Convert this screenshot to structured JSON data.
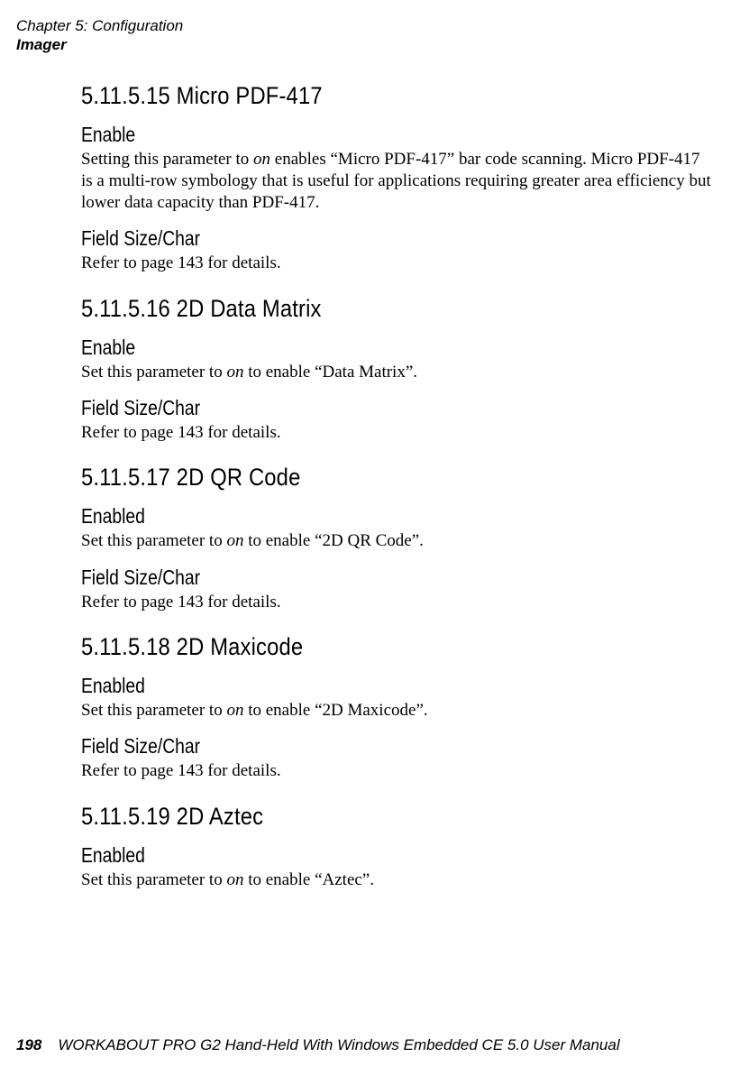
{
  "header": {
    "chapter_label": "Chapter 5: Configuration",
    "section_name": "Imager"
  },
  "sections": {
    "s1": {
      "title": "5.11.5.15  Micro PDF-417",
      "sub1_title": "Enable",
      "sub1_body_prefix": "Setting this parameter to ",
      "sub1_body_em": "on",
      "sub1_body_suffix": " enables “Micro PDF-417” bar code scanning. Micro PDF-417 is a multi-row symbology that is useful for applications requiring greater area efficiency but lower data capacity than PDF-417.",
      "sub2_title": "Field Size/Char",
      "sub2_body": "Refer to page 143 for details."
    },
    "s2": {
      "title": "5.11.5.16  2D Data Matrix",
      "sub1_title": "Enable",
      "sub1_body_prefix": "Set this parameter to ",
      "sub1_body_em": "on",
      "sub1_body_suffix": " to enable “Data Matrix”.",
      "sub2_title": "Field Size/Char",
      "sub2_body": "Refer to page 143 for details."
    },
    "s3": {
      "title": "5.11.5.17  2D QR Code",
      "sub1_title": "Enabled",
      "sub1_body_prefix": "Set this parameter to ",
      "sub1_body_em": "on",
      "sub1_body_suffix": " to enable “2D QR Code”.",
      "sub2_title": "Field Size/Char",
      "sub2_body": "Refer to page 143 for details."
    },
    "s4": {
      "title": "5.11.5.18  2D Maxicode",
      "sub1_title": "Enabled",
      "sub1_body_prefix": "Set this parameter to ",
      "sub1_body_em": "on",
      "sub1_body_suffix": " to enable “2D Maxicode”.",
      "sub2_title": "Field Size/Char",
      "sub2_body": "Refer to page 143 for details."
    },
    "s5": {
      "title": "5.11.5.19  2D Aztec",
      "sub1_title": "Enabled",
      "sub1_body_prefix": "Set this parameter to ",
      "sub1_body_em": "on",
      "sub1_body_suffix": " to enable “Aztec”."
    }
  },
  "footer": {
    "page_number": "198",
    "title": "WORKABOUT PRO G2 Hand-Held With Windows Embedded CE 5.0 User Manual"
  }
}
